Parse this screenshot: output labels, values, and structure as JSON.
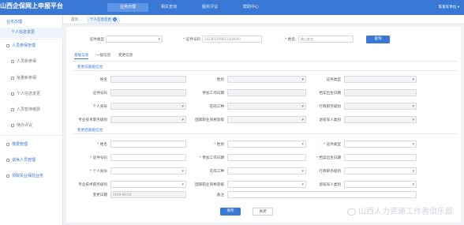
{
  "header": {
    "title": "山西企保网上申报平台",
    "nav": [
      "业务办理",
      "相关查询",
      "服务评议",
      "帮助中心"
    ],
    "user": "陈俊军单位 ▾"
  },
  "tabs": [
    "首页",
    "个人信息变更"
  ],
  "sidebar": {
    "items": [
      {
        "label": "业务办理",
        "kind": "group"
      },
      {
        "label": "个人信息变更",
        "kind": "sub-active"
      },
      {
        "label": "人员参保管理",
        "kind": "group"
      },
      {
        "label": "人员新参保",
        "kind": "sub"
      },
      {
        "label": "批量新参保",
        "kind": "sub"
      },
      {
        "label": "个人信息变更",
        "kind": "sub"
      },
      {
        "label": "人员暂停缴费",
        "kind": "sub"
      },
      {
        "label": "待办评议",
        "kind": "sub"
      },
      {
        "label": "缴费管理",
        "kind": "group"
      },
      {
        "label": "退休人员管理",
        "kind": "group"
      },
      {
        "label": "领取失业保险业务",
        "kind": "group"
      }
    ]
  },
  "search": {
    "cert_type_label": "证件类型",
    "cert_no_label": "证件号码",
    "cert_no_value": "142303199011160000",
    "name_label": "姓名",
    "name_placeholder": "输入姓名",
    "query_button": "查询"
  },
  "subtabs": [
    "基础信息",
    "一般信息",
    "变更信息"
  ],
  "section_before": {
    "title": "变更前基础信息",
    "rows": [
      [
        "姓名",
        "性别",
        "证件类型"
      ],
      [
        "证件号码",
        "参加工作日期",
        "档案出生日期"
      ],
      [
        "个人身份",
        "在岗工种",
        "行政职务级别"
      ],
      [
        "专业技术职务级别",
        "国家职业资格等级",
        "退役军人类别"
      ]
    ]
  },
  "section_after": {
    "title": "变更后基础信息",
    "rows": [
      [
        "姓名",
        "性别",
        "证件类型"
      ],
      [
        "证件号码",
        "参加工作日期",
        "档案出生日期"
      ],
      [
        "个人身份",
        "在岗工种",
        "行政职务级别"
      ],
      [
        "专业技术职务级别",
        "国家职业资格等级",
        "退役军人类别"
      ]
    ],
    "change_date_label": "变更日期",
    "change_date_value": "2019-06-03",
    "remark_label": "备注"
  },
  "actions": {
    "save": "保存",
    "close": "关闭"
  },
  "watermark": "山西人力资源工作者俱乐部",
  "colors": {
    "brand": "#3a78d6",
    "required": "#e0413a"
  }
}
